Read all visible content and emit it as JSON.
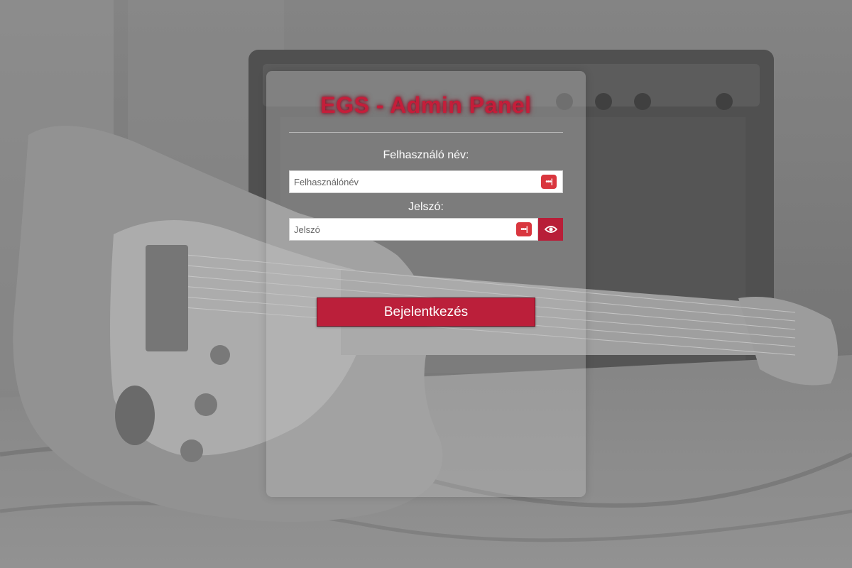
{
  "colors": {
    "accent": "#bb1f3a",
    "title": "#c41e3a",
    "password_manager_icon": "#d9363e"
  },
  "panel": {
    "title": "EGS - Admin Panel",
    "username_label": "Felhasználó név:",
    "username_placeholder": "Felhasználónév",
    "username_value": "",
    "password_label": "Jelszó:",
    "password_placeholder": "Jelszó",
    "password_value": "",
    "show_password_icon": "eye-icon",
    "password_manager_icon": "ellipsis-key-icon",
    "login_button": "Bejelentkezés"
  }
}
